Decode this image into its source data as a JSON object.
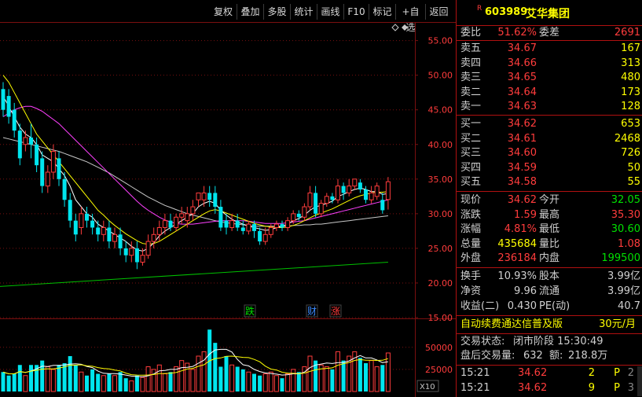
{
  "toolbar": {
    "buttons": [
      "复权",
      "叠加",
      "多股",
      "统计",
      "画线",
      "F10",
      "标记",
      "+自选",
      "返回"
    ]
  },
  "chart": {
    "price_axis": [
      "55.00",
      "50.00",
      "45.00",
      "40.00",
      "35.00",
      "30.00",
      "25.00",
      "20.00",
      "15.00"
    ],
    "volume_axis": [
      "50000",
      "25000"
    ],
    "volume_unit": "X10",
    "markers": [
      {
        "text": "跌",
        "color": "#00e000"
      },
      {
        "text": "财",
        "color": "#3c8cff"
      },
      {
        "text": "涨",
        "color": "#ff3c3c"
      }
    ],
    "colors": {
      "up": "#ff3c3c",
      "down": "#00e5ee",
      "ma5": "#ffffff",
      "ma10": "#ffff00",
      "ma20": "#ff40ff",
      "ma60": "#c8c8c8",
      "long": "#00c000",
      "grid": "#7a1010"
    }
  },
  "chart_data": {
    "type": "candlestick",
    "ylim": [
      15,
      57
    ],
    "vol_lim": [
      0,
      80000
    ],
    "bars": [
      {
        "o": 48,
        "c": 45,
        "h": 49,
        "l": 44,
        "v": 22000,
        "up": false
      },
      {
        "o": 47,
        "c": 44,
        "h": 48,
        "l": 43,
        "v": 18000,
        "up": false
      },
      {
        "o": 45,
        "c": 42,
        "h": 46,
        "l": 41,
        "v": 20000,
        "up": false
      },
      {
        "o": 42,
        "c": 38,
        "h": 43,
        "l": 37,
        "v": 30000,
        "up": false
      },
      {
        "o": 40,
        "c": 41,
        "h": 42,
        "l": 39,
        "v": 18000,
        "up": true
      },
      {
        "o": 41,
        "c": 40,
        "h": 43,
        "l": 38,
        "v": 30000,
        "up": false
      },
      {
        "o": 40,
        "c": 37,
        "h": 41,
        "l": 36,
        "v": 30000,
        "up": false
      },
      {
        "o": 38,
        "c": 34,
        "h": 39,
        "l": 33,
        "v": 35000,
        "up": false
      },
      {
        "o": 34,
        "c": 36,
        "h": 37,
        "l": 33,
        "v": 28000,
        "up": true
      },
      {
        "o": 36,
        "c": 39,
        "h": 40,
        "l": 35,
        "v": 25000,
        "up": true
      },
      {
        "o": 38,
        "c": 35,
        "h": 39,
        "l": 34,
        "v": 30000,
        "up": false
      },
      {
        "o": 35,
        "c": 32,
        "h": 36,
        "l": 31,
        "v": 32000,
        "up": false
      },
      {
        "o": 32,
        "c": 29,
        "h": 33,
        "l": 28,
        "v": 40000,
        "up": false
      },
      {
        "o": 29,
        "c": 27,
        "h": 30,
        "l": 26,
        "v": 30000,
        "up": false
      },
      {
        "o": 28,
        "c": 30,
        "h": 31,
        "l": 27,
        "v": 22000,
        "up": true
      },
      {
        "o": 30,
        "c": 29,
        "h": 31,
        "l": 28,
        "v": 18000,
        "up": false
      },
      {
        "o": 29,
        "c": 28,
        "h": 30,
        "l": 27,
        "v": 25000,
        "up": false
      },
      {
        "o": 28,
        "c": 27,
        "h": 29,
        "l": 26,
        "v": 20000,
        "up": false
      },
      {
        "o": 27,
        "c": 28,
        "h": 29,
        "l": 26,
        "v": 18000,
        "up": true
      },
      {
        "o": 28,
        "c": 26,
        "h": 29,
        "l": 25,
        "v": 20000,
        "up": false
      },
      {
        "o": 26,
        "c": 27,
        "h": 28,
        "l": 25,
        "v": 18000,
        "up": true
      },
      {
        "o": 27,
        "c": 25,
        "h": 28,
        "l": 24,
        "v": 22000,
        "up": false
      },
      {
        "o": 25,
        "c": 24,
        "h": 26,
        "l": 23,
        "v": 15000,
        "up": false
      },
      {
        "o": 24,
        "c": 25,
        "h": 26,
        "l": 23,
        "v": 12000,
        "up": true
      },
      {
        "o": 25,
        "c": 23,
        "h": 26,
        "l": 22,
        "v": 18000,
        "up": false
      },
      {
        "o": 23,
        "c": 24,
        "h": 25,
        "l": 22.5,
        "v": 16000,
        "up": true
      },
      {
        "o": 24,
        "c": 26,
        "h": 27,
        "l": 23.5,
        "v": 28000,
        "up": true
      },
      {
        "o": 26,
        "c": 27,
        "h": 28,
        "l": 25,
        "v": 25000,
        "up": true
      },
      {
        "o": 27,
        "c": 28,
        "h": 29,
        "l": 26,
        "v": 30000,
        "up": true
      },
      {
        "o": 28,
        "c": 29,
        "h": 30,
        "l": 27,
        "v": 20000,
        "up": true
      },
      {
        "o": 29,
        "c": 28,
        "h": 30,
        "l": 27.5,
        "v": 22000,
        "up": false
      },
      {
        "o": 28,
        "c": 29.5,
        "h": 30,
        "l": 27.5,
        "v": 28000,
        "up": true
      },
      {
        "o": 29.5,
        "c": 30,
        "h": 31,
        "l": 28.5,
        "v": 35000,
        "up": true
      },
      {
        "o": 29,
        "c": 30,
        "h": 31,
        "l": 28,
        "v": 32000,
        "up": true
      },
      {
        "o": 30,
        "c": 31,
        "h": 32,
        "l": 29,
        "v": 25000,
        "up": true
      },
      {
        "o": 32,
        "c": 33,
        "h": 33,
        "l": 31,
        "v": 40000,
        "up": true
      },
      {
        "o": 32,
        "c": 33,
        "h": 34,
        "l": 31,
        "v": 45000,
        "up": true
      },
      {
        "o": 33,
        "c": 32,
        "h": 34,
        "l": 31,
        "v": 70000,
        "up": false
      },
      {
        "o": 33,
        "c": 31,
        "h": 34,
        "l": 30,
        "v": 55000,
        "up": false
      },
      {
        "o": 31,
        "c": 28,
        "h": 32,
        "l": 27.5,
        "v": 28000,
        "up": false
      },
      {
        "o": 29,
        "c": 28,
        "h": 30,
        "l": 27,
        "v": 40000,
        "up": false
      },
      {
        "o": 28,
        "c": 29,
        "h": 30,
        "l": 27.5,
        "v": 30000,
        "up": true
      },
      {
        "o": 29,
        "c": 28,
        "h": 30,
        "l": 27.5,
        "v": 28000,
        "up": false
      },
      {
        "o": 28,
        "c": 27.5,
        "h": 29,
        "l": 27,
        "v": 25000,
        "up": false
      },
      {
        "o": 27.5,
        "c": 28.5,
        "h": 29,
        "l": 27,
        "v": 22000,
        "up": true
      },
      {
        "o": 28.5,
        "c": 27.5,
        "h": 29,
        "l": 26.5,
        "v": 20000,
        "up": false
      },
      {
        "o": 27.5,
        "c": 26,
        "h": 28,
        "l": 25.5,
        "v": 18000,
        "up": false
      },
      {
        "o": 26,
        "c": 27,
        "h": 28,
        "l": 25.5,
        "v": 20000,
        "up": true
      },
      {
        "o": 27,
        "c": 28,
        "h": 28.5,
        "l": 26.5,
        "v": 22000,
        "up": true
      },
      {
        "o": 28,
        "c": 28.5,
        "h": 29,
        "l": 27.5,
        "v": 18000,
        "up": true
      },
      {
        "o": 28.5,
        "c": 28,
        "h": 29,
        "l": 27.5,
        "v": 15000,
        "up": false
      },
      {
        "o": 28,
        "c": 29,
        "h": 29.5,
        "l": 27.5,
        "v": 20000,
        "up": true
      },
      {
        "o": 29,
        "c": 30,
        "h": 30.5,
        "l": 28.5,
        "v": 25000,
        "up": true
      },
      {
        "o": 30,
        "c": 29.5,
        "h": 30.5,
        "l": 29,
        "v": 22000,
        "up": false
      },
      {
        "o": 29.5,
        "c": 31,
        "h": 31.5,
        "l": 29,
        "v": 28000,
        "up": true
      },
      {
        "o": 31,
        "c": 33,
        "h": 34,
        "l": 30.5,
        "v": 40000,
        "up": true
      },
      {
        "o": 33,
        "c": 30,
        "h": 34,
        "l": 29.5,
        "v": 35000,
        "up": false
      },
      {
        "o": 30,
        "c": 31.5,
        "h": 32,
        "l": 29.5,
        "v": 30000,
        "up": true
      },
      {
        "o": 31.5,
        "c": 32.5,
        "h": 33,
        "l": 31,
        "v": 28000,
        "up": true
      },
      {
        "o": 32.5,
        "c": 32,
        "h": 33,
        "l": 31.5,
        "v": 25000,
        "up": false
      },
      {
        "o": 32,
        "c": 34,
        "h": 35,
        "l": 31.5,
        "v": 45000,
        "up": true
      },
      {
        "o": 34,
        "c": 33,
        "h": 34.5,
        "l": 32,
        "v": 35000,
        "up": false
      },
      {
        "o": 33,
        "c": 34,
        "h": 35,
        "l": 32.5,
        "v": 40000,
        "up": true
      },
      {
        "o": 34,
        "c": 35,
        "h": 35,
        "l": 33.5,
        "v": 45000,
        "up": true
      },
      {
        "o": 34.5,
        "c": 33.5,
        "h": 35,
        "l": 33,
        "v": 38000,
        "up": false
      },
      {
        "o": 33.5,
        "c": 32,
        "h": 34,
        "l": 31.5,
        "v": 32000,
        "up": false
      },
      {
        "o": 32,
        "c": 33,
        "h": 34,
        "l": 31.5,
        "v": 35000,
        "up": true
      },
      {
        "o": 32.5,
        "c": 34,
        "h": 34.5,
        "l": 32,
        "v": 28000,
        "up": true
      },
      {
        "o": 32,
        "c": 30.5,
        "h": 33,
        "l": 30,
        "v": 30000,
        "up": false
      },
      {
        "o": 32.05,
        "c": 34.62,
        "h": 35.3,
        "l": 30.6,
        "v": 43568,
        "up": true
      }
    ],
    "ma5": [
      47,
      45.5,
      44,
      42.5,
      41.5,
      41,
      40,
      38.5,
      38,
      37.5,
      36.5,
      35.5,
      34,
      32,
      31,
      30,
      29.5,
      28.5,
      28,
      27.5,
      27,
      26.5,
      26,
      25.3,
      24.8,
      24.6,
      25,
      25.8,
      26.8,
      27.5,
      28,
      28.5,
      29,
      29.5,
      30,
      31,
      31.5,
      31.8,
      31.5,
      30.5,
      29.8,
      29.2,
      28.8,
      28.5,
      28.2,
      28,
      27.8,
      27.6,
      27.7,
      28,
      28.2,
      28.5,
      29,
      29.3,
      29.8,
      30.5,
      31,
      31.2,
      31.5,
      31.8,
      32.5,
      32.8,
      33.2,
      33.5,
      33.7,
      33.5,
      33.2,
      33.2,
      32.8,
      32.9
    ],
    "ma10": [
      50,
      49,
      47.5,
      46,
      44.5,
      43,
      41.5,
      40.5,
      39.5,
      38.5,
      37.5,
      36.5,
      35.5,
      34.5,
      33.5,
      32.5,
      31.5,
      30.5,
      29.8,
      29,
      28.3,
      27.7,
      27.1,
      26.6,
      26.1,
      25.7,
      25.6,
      25.7,
      26,
      26.5,
      27,
      27.5,
      28,
      28.5,
      29,
      29.5,
      30,
      30.4,
      30.6,
      30.4,
      30.1,
      29.8,
      29.5,
      29.2,
      28.9,
      28.6,
      28.4,
      28.2,
      28.1,
      28,
      28,
      28.1,
      28.3,
      28.6,
      29,
      29.4,
      29.8,
      30.1,
      30.4,
      30.7,
      31.1,
      31.5,
      31.9,
      32.3,
      32.6,
      32.8,
      33,
      33.1,
      33.1,
      33.2
    ],
    "ma20": [
      44,
      44.5,
      45,
      45.3,
      45.5,
      45.5,
      45.2,
      44.8,
      44.2,
      43.6,
      43,
      42.2,
      41.4,
      40.6,
      39.8,
      39,
      38.2,
      37.4,
      36.6,
      35.8,
      35,
      34.2,
      33.4,
      32.6,
      31.8,
      31.1,
      30.5,
      30,
      29.5,
      29.1,
      28.8,
      28.6,
      28.5,
      28.5,
      28.5,
      28.6,
      28.7,
      28.8,
      28.9,
      29,
      29,
      29,
      29,
      29,
      28.9,
      28.8,
      28.7,
      28.6,
      28.6,
      28.6,
      28.6,
      28.7,
      28.8,
      28.9,
      29,
      29.2,
      29.4,
      29.6,
      29.8,
      30,
      30.2,
      30.4,
      30.6,
      30.8,
      31,
      31.2,
      31.4,
      31.6,
      31.8,
      32
    ],
    "ma60": [
      41,
      40.8,
      40.6,
      40.4,
      40.2,
      40,
      39.8,
      39.6,
      39.4,
      39.2,
      39,
      38.7,
      38.4,
      38.1,
      37.8,
      37.5,
      37.1,
      36.7,
      36.3,
      35.9,
      35.4,
      34.9,
      34.4,
      33.9,
      33.4,
      32.9,
      32.4,
      32,
      31.6,
      31.2,
      30.9,
      30.6,
      30.3,
      30,
      29.8,
      29.6,
      29.4,
      29.2,
      29,
      28.8,
      28.7,
      28.6,
      28.5,
      28.4,
      28.3,
      28.2,
      28.2,
      28.2,
      28.2,
      28.2,
      28.2,
      28.2,
      28.3,
      28.3,
      28.4,
      28.4,
      28.5,
      28.5,
      28.6,
      28.7,
      28.8,
      28.9,
      29,
      29.1,
      29.2,
      29.3,
      29.4,
      29.5,
      29.6,
      29.7
    ],
    "long_line": [
      19.5,
      23
    ]
  },
  "stock": {
    "badge": "R",
    "code": "603989",
    "name": "艾华集团"
  },
  "quote": {
    "weibi_label": "委比",
    "weibi_value": "51.62%",
    "weicha_label": "委差",
    "weicha_value": "2691",
    "asks": [
      {
        "label": "卖五",
        "price": "34.67",
        "vol": "167"
      },
      {
        "label": "卖四",
        "price": "34.66",
        "vol": "313"
      },
      {
        "label": "卖三",
        "price": "34.65",
        "vol": "480"
      },
      {
        "label": "卖二",
        "price": "34.64",
        "vol": "173"
      },
      {
        "label": "卖一",
        "price": "34.63",
        "vol": "128"
      }
    ],
    "bids": [
      {
        "label": "买一",
        "price": "34.62",
        "vol": "653"
      },
      {
        "label": "买二",
        "price": "34.61",
        "vol": "2468"
      },
      {
        "label": "买三",
        "price": "34.60",
        "vol": "726"
      },
      {
        "label": "买四",
        "price": "34.59",
        "vol": "50"
      },
      {
        "label": "买五",
        "price": "34.58",
        "vol": "55"
      }
    ],
    "stats": [
      {
        "l1": "现价",
        "v1": "34.62",
        "c1": "r",
        "l2": "今开",
        "v2": "32.05",
        "c2": "g"
      },
      {
        "l1": "涨跌",
        "v1": "1.59",
        "c1": "r",
        "l2": "最高",
        "v2": "35.30",
        "c2": "r"
      },
      {
        "l1": "涨幅",
        "v1": "4.81%",
        "c1": "r",
        "l2": "最低",
        "v2": "30.60",
        "c2": "g"
      },
      {
        "l1": "总量",
        "v1": "435684",
        "c1": "y",
        "l2": "量比",
        "v2": "1.08",
        "c2": "r"
      },
      {
        "l1": "外盘",
        "v1": "236184",
        "c1": "r",
        "l2": "内盘",
        "v2": "199500",
        "c2": "g"
      }
    ],
    "fin": [
      {
        "l1": "换手",
        "v1": "10.93%",
        "l2": "股本",
        "v2": "3.99亿"
      },
      {
        "l1": "净资",
        "v1": "9.96",
        "l2": "流通",
        "v2": "3.99亿"
      },
      {
        "l1": "收益(二)",
        "v1": "0.430",
        "l2": "PE(动)",
        "v2": "40.7"
      }
    ],
    "promo_text": "自动续费通达信普及版",
    "promo_price": "30元/月",
    "status_label": "交易状态:",
    "status_value": "闭市阶段 15:30:49",
    "after_label": "盘后交易量:",
    "after_vol": "632",
    "after_amt_label": "额:",
    "after_amt": "218.8万",
    "ticks": [
      {
        "time": "15:21",
        "price": "34.62",
        "vol": "2",
        "side": "P",
        "n": "2"
      },
      {
        "time": "15:21",
        "price": "34.62",
        "vol": "9",
        "side": "P",
        "n": "3"
      }
    ]
  }
}
